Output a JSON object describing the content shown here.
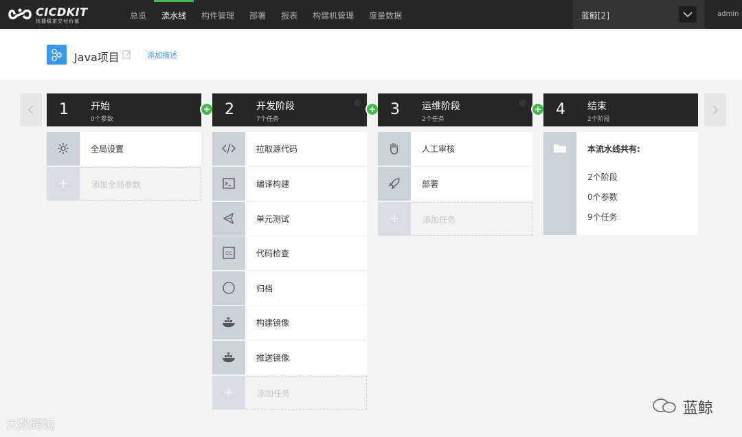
{
  "app": {
    "logo_name": "CICDKIT",
    "logo_tagline": "快捷稳定交付价值"
  },
  "nav": {
    "items": [
      {
        "label": "总览",
        "active": false
      },
      {
        "label": "流水线",
        "active": true
      },
      {
        "label": "构件管理",
        "active": false
      },
      {
        "label": "部署",
        "active": false
      },
      {
        "label": "报表",
        "active": false
      },
      {
        "label": "构建机管理",
        "active": false
      },
      {
        "label": "度量数据",
        "active": false
      }
    ],
    "user_select": "蓝鲸[2]",
    "admin_label": "admin"
  },
  "project": {
    "name": "Java项目",
    "add_desc_label": "添加描述"
  },
  "stages": [
    {
      "num": "1",
      "title": "开始",
      "sub": "0个参数",
      "tasks": [
        {
          "icon": "gear-icon",
          "label": "全局设置"
        }
      ],
      "add_label": "添加全局参数"
    },
    {
      "num": "2",
      "title": "开发阶段",
      "sub": "7个任务",
      "tasks": [
        {
          "icon": "code-icon",
          "label": "拉取源代码"
        },
        {
          "icon": "terminal-icon",
          "label": "编译构建"
        },
        {
          "icon": "unit-test-icon",
          "label": "单元测试"
        },
        {
          "icon": "code-check-icon",
          "label": "代码检查"
        },
        {
          "icon": "archive-icon",
          "label": "归档"
        },
        {
          "icon": "docker-icon",
          "label": "构建镜像"
        },
        {
          "icon": "docker-icon",
          "label": "推送镜像"
        }
      ],
      "add_label": "添加任务"
    },
    {
      "num": "3",
      "title": "运维阶段",
      "sub": "2个任务",
      "tasks": [
        {
          "icon": "hand-icon",
          "label": "人工审核"
        },
        {
          "icon": "rocket-icon",
          "label": "部署"
        }
      ],
      "add_label": "添加任务"
    },
    {
      "num": "4",
      "title": "结束",
      "sub": "2个阶段",
      "summary_title": "本流水线共有:",
      "summary_lines": [
        "2个阶段",
        "0个参数",
        "9个任务"
      ]
    }
  ],
  "watermarks": {
    "left": "大数跨境",
    "right": "蓝鲸"
  },
  "colors": {
    "topbar": "#262626",
    "accent_green": "#45b649",
    "link_blue": "#3c97e8",
    "icon_bg": "#ccd1d9"
  }
}
